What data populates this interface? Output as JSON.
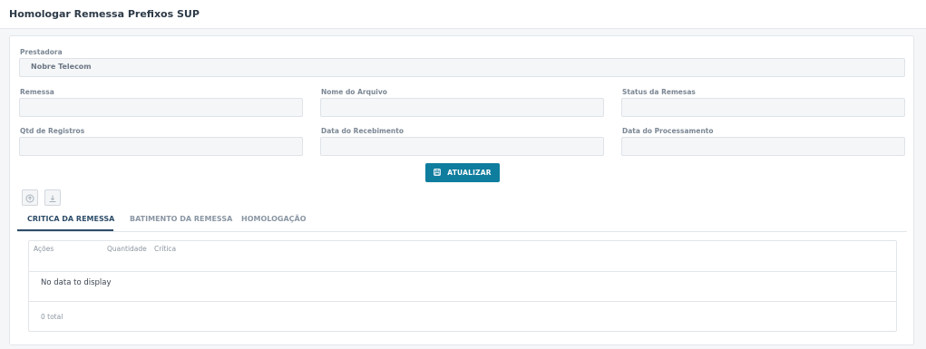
{
  "page": {
    "title": "Homologar Remessa Prefixos SUP"
  },
  "form": {
    "prestadora": {
      "label": "Prestadora",
      "value": "Nobre Telecom"
    },
    "remessa": {
      "label": "Remessa",
      "value": ""
    },
    "nome_arquivo": {
      "label": "Nome do Arquivo",
      "value": ""
    },
    "status_remessas": {
      "label": "Status da Remesas",
      "value": ""
    },
    "qtd_registros": {
      "label": "Qtd de Registros",
      "value": ""
    },
    "data_recebimento": {
      "label": "Data do Recebimento",
      "value": ""
    },
    "data_processamento": {
      "label": "Data do Processamento",
      "value": ""
    }
  },
  "actions": {
    "atualizar_label": "ATUALIZAR",
    "upload_icon": "upload-icon",
    "download_icon": "download-icon"
  },
  "tabs": [
    {
      "label": "CRITICA DA REMESSA",
      "active": true
    },
    {
      "label": "BATIMENTO DA REMESSA",
      "active": false
    },
    {
      "label": "HOMOLOGAÇÃO",
      "active": false
    }
  ],
  "grid": {
    "columns": [
      "Ações",
      "Quantidade",
      "Crítica"
    ],
    "empty_message": "No data to display",
    "footer_total": "0 total"
  },
  "colors": {
    "primary": "#0f7d9e",
    "active_tab": "#2e4d69"
  }
}
